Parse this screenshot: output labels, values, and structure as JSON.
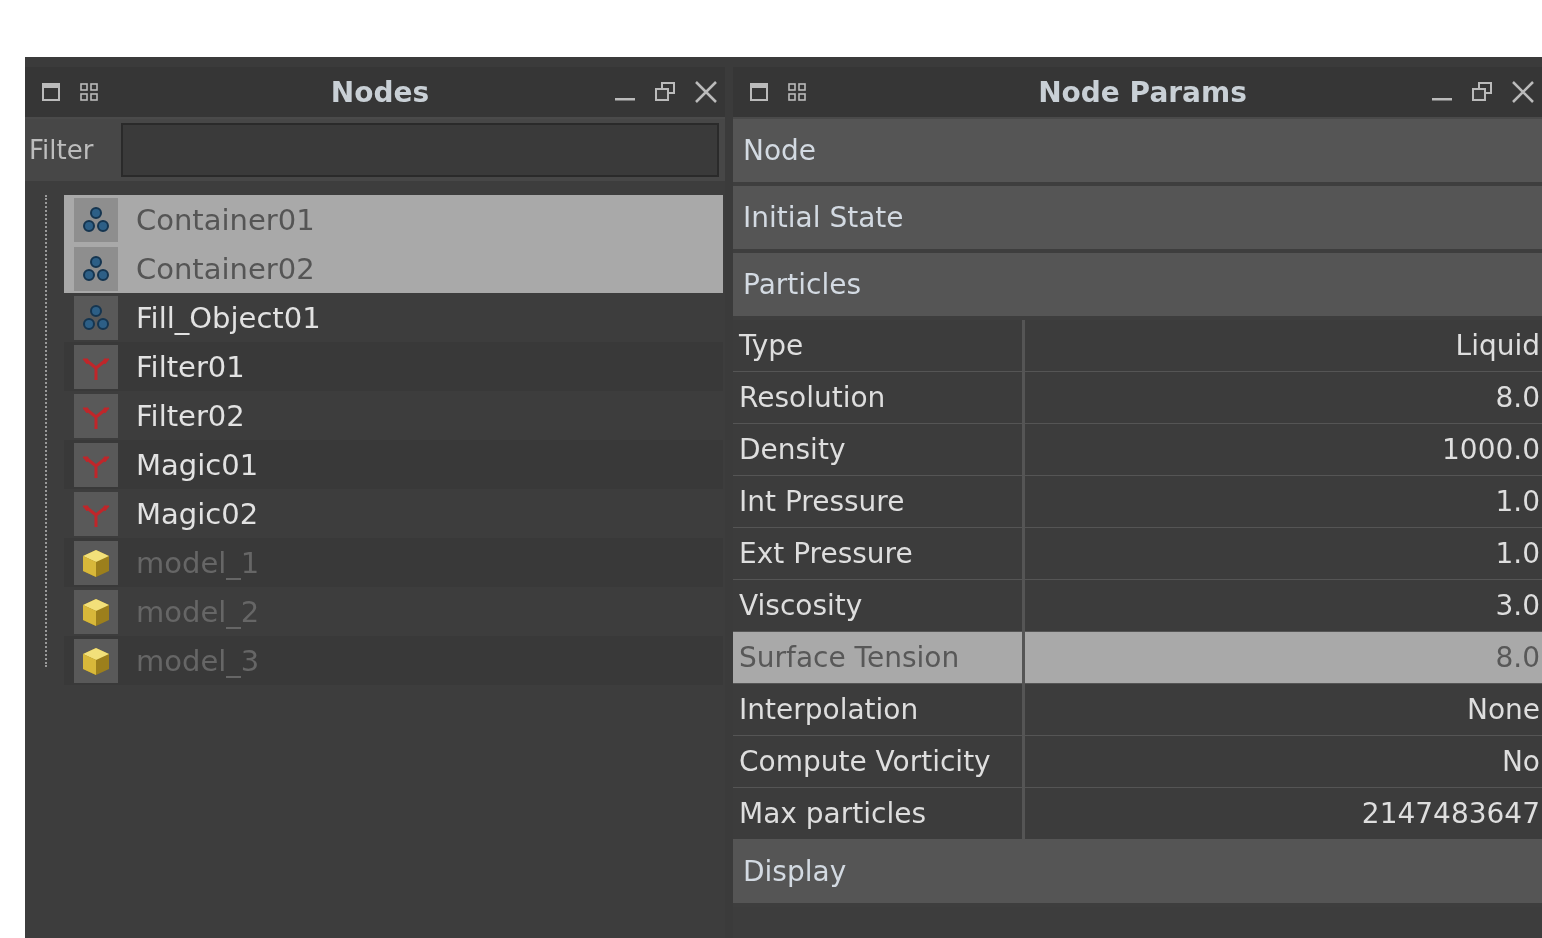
{
  "nodes_panel": {
    "title": "Nodes",
    "filter": {
      "label": "Filter"
    },
    "tree": [
      {
        "name": "Container01",
        "kind": "container",
        "selected": true,
        "disabled": false
      },
      {
        "name": "Container02",
        "kind": "container",
        "selected": true,
        "disabled": false
      },
      {
        "name": "Fill_Object01",
        "kind": "container",
        "selected": false,
        "disabled": false
      },
      {
        "name": "Filter01",
        "kind": "filter",
        "selected": false,
        "disabled": false
      },
      {
        "name": "Filter02",
        "kind": "filter",
        "selected": false,
        "disabled": false
      },
      {
        "name": "Magic01",
        "kind": "filter",
        "selected": false,
        "disabled": false
      },
      {
        "name": "Magic02",
        "kind": "filter",
        "selected": false,
        "disabled": false
      },
      {
        "name": "model_1",
        "kind": "model",
        "selected": false,
        "disabled": true
      },
      {
        "name": "model_2",
        "kind": "model",
        "selected": false,
        "disabled": true
      },
      {
        "name": "model_3",
        "kind": "model",
        "selected": false,
        "disabled": true
      }
    ]
  },
  "params_panel": {
    "title": "Node Params",
    "sections": [
      {
        "title": "Node"
      },
      {
        "title": "Initial State"
      },
      {
        "title": "Particles",
        "rows": [
          {
            "label": "Type",
            "value": "Liquid",
            "selected": false
          },
          {
            "label": "Resolution",
            "value": "8.0",
            "selected": false
          },
          {
            "label": "Density",
            "value": "1000.0",
            "selected": false
          },
          {
            "label": "Int Pressure",
            "value": "1.0",
            "selected": false
          },
          {
            "label": "Ext Pressure",
            "value": "1.0",
            "selected": false
          },
          {
            "label": "Viscosity",
            "value": "3.0",
            "selected": false
          },
          {
            "label": "Surface Tension",
            "value": "8.0",
            "selected": true
          },
          {
            "label": "Interpolation",
            "value": "None",
            "selected": false
          },
          {
            "label": "Compute Vorticity",
            "value": "No",
            "selected": false
          },
          {
            "label": "Max particles",
            "value": "2147483647",
            "selected": false
          }
        ]
      },
      {
        "title": "Display"
      }
    ]
  }
}
